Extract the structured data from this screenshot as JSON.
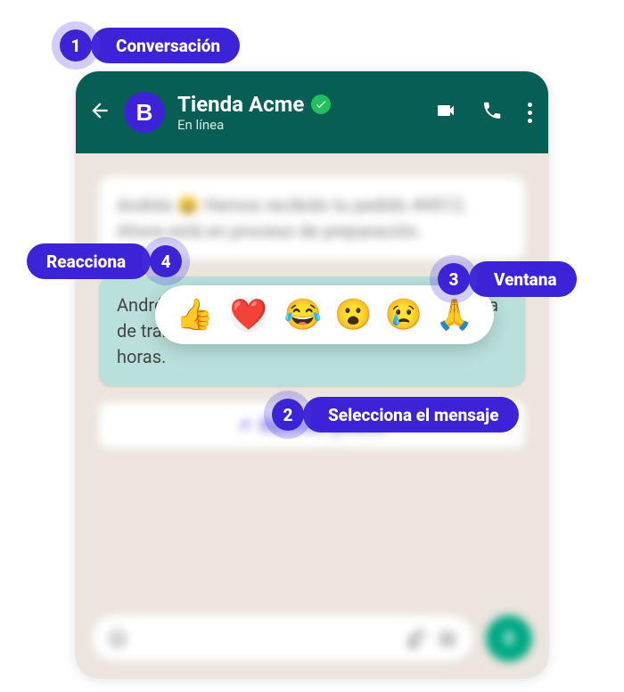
{
  "header": {
    "avatar_letter": "B",
    "contact_name": "Tienda Acme",
    "status": "En línea"
  },
  "messages": {
    "msg1_text": "Andrés 😄 Hemos recibido tu pedido #4512. Ahora está en proceso de preparación.",
    "msg2_text": "Andrés, tu pedido ya fue entregado a la empresa de transporte 🚛 Llegará en las próximas 24 horas.",
    "action_button": "Rastrear pedido"
  },
  "reactions": {
    "r0": "👍",
    "r1": "❤️",
    "r2": "😂",
    "r3": "😮",
    "r4": "😢",
    "r5": "🙏"
  },
  "callouts": {
    "c1_num": "1",
    "c1_label": "Conversación",
    "c2_num": "2",
    "c2_label": "Selecciona el mensaje",
    "c3_num": "3",
    "c3_label": "Ventana",
    "c4_num": "4",
    "c4_label": "Reacciona"
  }
}
